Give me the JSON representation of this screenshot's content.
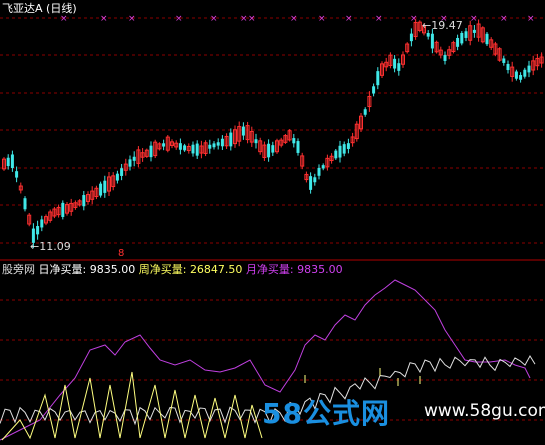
{
  "panel_top": {
    "title": "飞亚达A",
    "period": "(日线)",
    "high_label": "19.47",
    "low_label": "11.09",
    "red_marker": "8"
  },
  "panel_bottom": {
    "site_label": "股旁网",
    "daily_label": "日净买量:",
    "daily_value": "9835.00",
    "weekly_label": "周净买量:",
    "weekly_value": "26847.50",
    "monthly_label": "月净买量:",
    "monthly_value": "9835.00"
  },
  "watermark": {
    "brand": "58公式网",
    "url": "www.58gu.com"
  },
  "colors": {
    "up": "#ff3030",
    "down": "#40e8e8",
    "grid": "#8b0000",
    "purple": "#c040e0",
    "yellow": "#ffff80",
    "white": "#e0e0e0"
  }
}
